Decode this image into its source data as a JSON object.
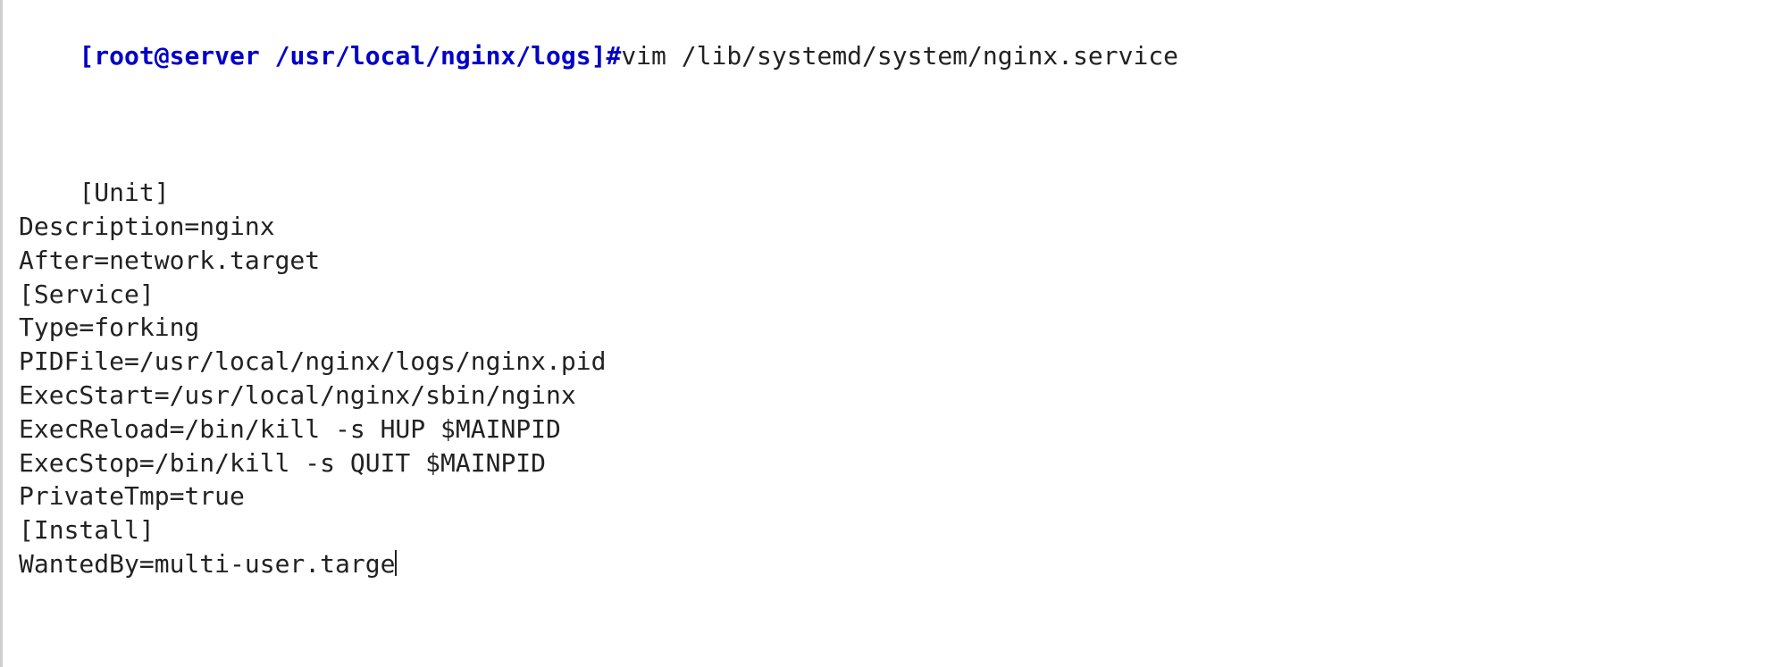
{
  "prompt": "[root@server /usr/local/nginx/logs]#",
  "command": "vim /lib/systemd/system/nginx.service",
  "file_lines": [
    "[Unit]",
    "Description=nginx",
    "After=network.target",
    "[Service]",
    "Type=forking",
    "PIDFile=/usr/local/nginx/logs/nginx.pid",
    "ExecStart=/usr/local/nginx/sbin/nginx",
    "ExecReload=/bin/kill -s HUP $MAINPID",
    "ExecStop=/bin/kill -s QUIT $MAINPID",
    "PrivateTmp=true",
    "[Install]",
    "WantedBy=multi-user.targe"
  ]
}
